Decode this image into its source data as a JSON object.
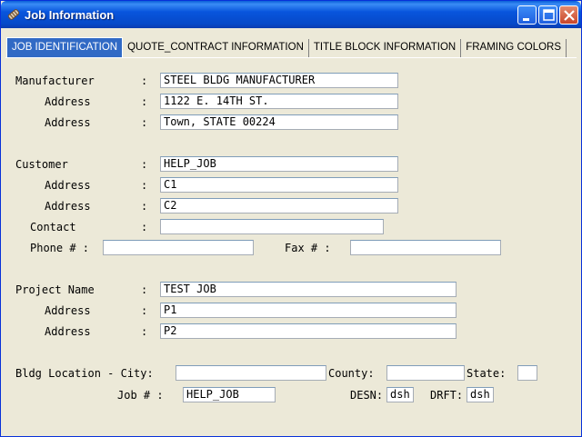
{
  "window": {
    "title": "Job Information"
  },
  "tabs": [
    "JOB IDENTIFICATION",
    "QUOTE_CONTRACT INFORMATION",
    "TITLE BLOCK INFORMATION",
    "FRAMING COLORS"
  ],
  "labels": {
    "manufacturer": "Manufacturer",
    "address": "Address",
    "customer": "Customer",
    "contact": "Contact",
    "phone": "Phone # :",
    "fax": "Fax # :",
    "project_name": "Project Name",
    "bldg_city": "Bldg Location - City:",
    "county": "County:",
    "state": "State:",
    "job": "Job # :",
    "desn": "DESN:",
    "drft": "DRFT:",
    "colon": ":"
  },
  "values": {
    "manufacturer": "STEEL BLDG MANUFACTURER",
    "manufacturer_address1": "1122 E. 14TH ST.",
    "manufacturer_address2": "Town, STATE 00224",
    "customer": "HELP_JOB",
    "customer_address1": "C1",
    "customer_address2": "C2",
    "contact": "",
    "phone": "",
    "fax": "",
    "project_name": "TEST JOB",
    "project_address1": "P1",
    "project_address2": "P2",
    "city": "",
    "county": "",
    "state": "",
    "job_number": "HELP_JOB",
    "desn": "dsh",
    "drft": "dsh"
  }
}
